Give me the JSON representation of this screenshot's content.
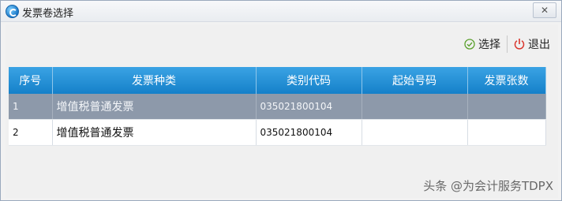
{
  "window": {
    "title": "发票卷选择",
    "close_label": "✕"
  },
  "toolbar": {
    "select_label": "选择",
    "exit_label": "退出"
  },
  "table": {
    "columns": [
      "序号",
      "发票种类",
      "类别代码",
      "起始号码",
      "发票张数"
    ],
    "rows": [
      {
        "index": "1",
        "type": "增值税普通发票",
        "code": "035021800104",
        "start_no": "",
        "count": "",
        "selected": true
      },
      {
        "index": "2",
        "type": "增值税普通发票",
        "code": "035021800104",
        "start_no": "",
        "count": "",
        "selected": false
      }
    ]
  },
  "watermark": "头条 @为会计服务TDPX",
  "colors": {
    "header": "#1a86cd",
    "selected_row": "#8d99aa",
    "select_icon": "#5aa02c",
    "exit_icon": "#d9342b"
  }
}
